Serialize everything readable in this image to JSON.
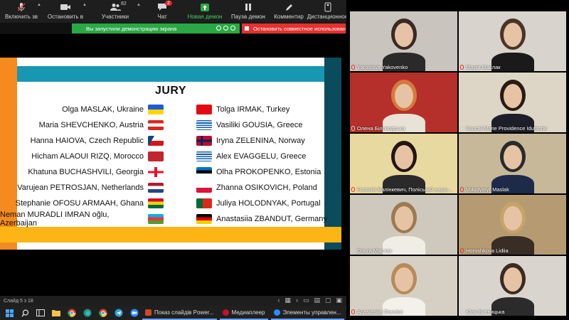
{
  "toolbar": {
    "items": [
      {
        "label": "Включить зв",
        "icon": "mic-muted-icon"
      },
      {
        "label": "Остановить в",
        "icon": "video-camera-icon"
      },
      {
        "label": "Участники",
        "icon": "participants-icon",
        "count": "82"
      },
      {
        "label": "Чат",
        "icon": "chat-icon",
        "badge": "2"
      },
      {
        "label": "Новая демон",
        "icon": "share-screen-icon"
      },
      {
        "label": "Пауза демон",
        "icon": "pause-icon"
      },
      {
        "label": "Комментир",
        "icon": "annotate-icon"
      },
      {
        "label": "Дистанционное",
        "icon": "remote-control-icon"
      }
    ]
  },
  "notices": {
    "sharing": "Вы запустили демонстрацию экрана",
    "stop": "Остановить совместное использован"
  },
  "slide": {
    "title": "JURY",
    "left": [
      {
        "name": "Olga MASLAK, Ukraine",
        "flag": "ukraine"
      },
      {
        "name": "Maria SHEVCHENKO, Austria",
        "flag": "austria"
      },
      {
        "name": "Hanna HAIOVA, Czech Republic",
        "flag": "czech"
      },
      {
        "name": "Hicham ALAOUI RIZQ, Morocco",
        "flag": "morocco"
      },
      {
        "name": "Khatuna BUCHASHVILI, Georgia",
        "flag": "georgia"
      },
      {
        "name": "Varujean PETROSJAN, Netherlands",
        "flag": "netherlands"
      },
      {
        "name": "Stephanie OFOSU ARMAAH, Ghana",
        "flag": "ghana"
      },
      {
        "name": "Neman MURADLI IMRAN oğlu, Azerbaijan",
        "flag": "azerbaijan"
      }
    ],
    "right": [
      {
        "name": "Tolga IRMAK, Turkey",
        "flag": "turkey"
      },
      {
        "name": "Vasiliki GOUSIA, Greece",
        "flag": "greece"
      },
      {
        "name": "Iryna ZELENINA, Norway",
        "flag": "norway"
      },
      {
        "name": "Alex EVAGGELU, Greece",
        "flag": "greece"
      },
      {
        "name": "Olha PROKOPENKO, Estonia",
        "flag": "estonia"
      },
      {
        "name": "Zhanna OSIKOVICH, Poland",
        "flag": "poland"
      },
      {
        "name": "Juliya HOLODNYAK, Portugal",
        "flag": "portugal"
      },
      {
        "name": "Anastasiia ZBANDUT, Germany",
        "flag": "germany"
      }
    ]
  },
  "statusbar": {
    "slide_counter": "Слайд 5 з 18"
  },
  "taskbar": {
    "apps": [
      {
        "label": "Показ слайдів Power...",
        "color": "#d24726"
      },
      {
        "label": "Медиаплеер",
        "color": "#c8102e"
      },
      {
        "label": "Элементы управлен...",
        "color": "#2d8cff"
      }
    ]
  },
  "participants": [
    {
      "name": "Yaroslava Yakovenko",
      "bg": "#c9c4bd",
      "hair": "#3a2a22",
      "shirt": "#2a2a2a",
      "muted": true
    },
    {
      "name": "Марія Маслак",
      "bg": "#d8d3cc",
      "hair": "#4a3426",
      "shirt": "#1a1a1a",
      "muted": true
    },
    {
      "name": "Олена Біловодська",
      "bg": "#b5302a",
      "hair": "#d47a3c",
      "shirt": "#e9e2d6",
      "muted": false
    },
    {
      "name": "Faucal-Marie Providence Idufashe",
      "bg": "#ddd6c7",
      "hair": "#2a1a12",
      "shirt": "#1e1e2a",
      "muted": false
    },
    {
      "name": "Наталія Валінкевич, Поліський націо...",
      "bg": "#e8d9a0",
      "hair": "#241611",
      "shirt": "#2a2a2a",
      "muted": true
    },
    {
      "name": "Volodymyr Maslak",
      "bg": "#c7b89a",
      "hair": "#2a2a2a",
      "shirt": "#1e2a4a",
      "muted": true
    },
    {
      "name": "Ольга Маслак",
      "bg": "#cfc8bd",
      "hair": "#9c7a52",
      "shirt": "#f0ede6",
      "muted": false
    },
    {
      "name": "Horoshkova Lidiia",
      "bg": "#b69a72",
      "hair": "#c7a46a",
      "shirt": "#3a2d25",
      "muted": true
    },
    {
      "name": "Anastasiia Zbandut",
      "bg": "#d6d0c4",
      "hair": "#b88a5a",
      "shirt": "#f4f0ea",
      "muted": true
    },
    {
      "name": "Юля Витвицька",
      "bg": "#d9d5ce",
      "hair": "#3b2a22",
      "shirt": "#2b2b2b",
      "muted": false
    }
  ]
}
